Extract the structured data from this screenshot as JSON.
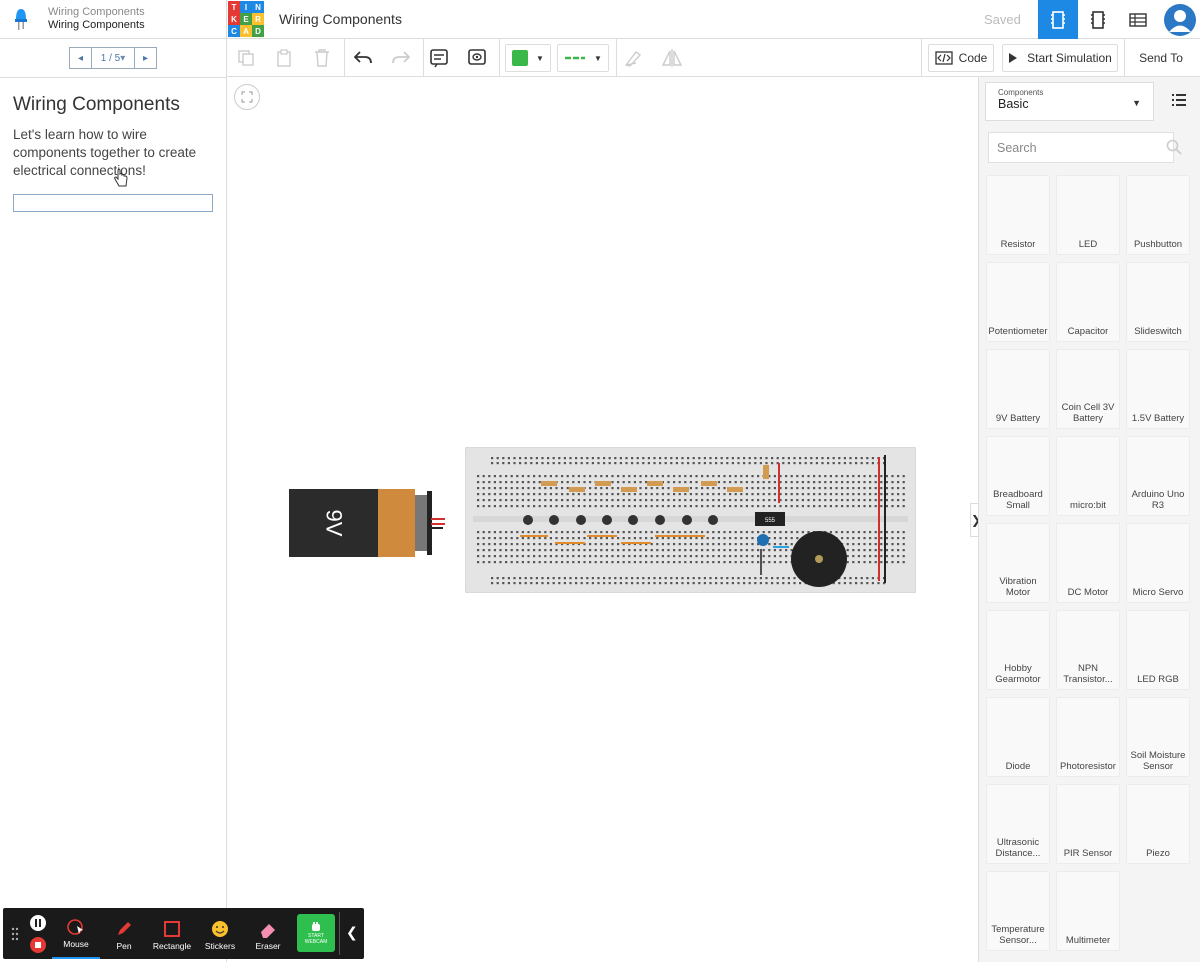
{
  "lesson_panel": {
    "breadcrumb_top": "Wiring Components",
    "breadcrumb_current": "Wiring Components",
    "pager": "1 / 5",
    "title": "Wiring Components",
    "body": "Let's learn how to wire components together to create electrical connections!"
  },
  "topbar": {
    "logo_letters": [
      "T",
      "I",
      "N",
      "K",
      "E",
      "R",
      "C",
      "A",
      "D"
    ],
    "logo_colors": [
      "#e53935",
      "#1e88e5",
      "#1e88e5",
      "#e53935",
      "#43a047",
      "#fbc02d",
      "#1e88e5",
      "#fbc02d",
      "#43a047"
    ],
    "title": "Wiring Components",
    "saved": "Saved",
    "view_icons": [
      "circuit-view-icon",
      "schematic-view-icon",
      "component-list-icon"
    ],
    "active_accent": "#1e88e5"
  },
  "toolbar": {
    "code": "Code",
    "start_simulation": "Start Simulation",
    "send_to": "Send To",
    "wire_color": "#3bb84a"
  },
  "circuit": {
    "battery_label": "9V",
    "chip_label": "555"
  },
  "components_panel": {
    "label": "Components",
    "selected": "Basic",
    "search_placeholder": "Search",
    "items": [
      "Resistor",
      "LED",
      "Pushbutton",
      "Potentiometer",
      "Capacitor",
      "Slideswitch",
      "9V Battery",
      "Coin Cell 3V Battery",
      "1.5V Battery",
      "Breadboard Small",
      "micro:bit",
      "Arduino Uno R3",
      "Vibration Motor",
      "DC Motor",
      "Micro Servo",
      "Hobby Gearmotor",
      "NPN Transistor...",
      "LED RGB",
      "Diode",
      "Photoresistor",
      "Soil Moisture Sensor",
      "Ultrasonic Distance...",
      "PIR Sensor",
      "Piezo",
      "Temperature Sensor...",
      "Multimeter"
    ]
  },
  "recorder": {
    "tools": [
      "Mouse",
      "Pen",
      "Rectangle",
      "Stickers",
      "Eraser"
    ],
    "webcam": "START WEBCAM"
  }
}
